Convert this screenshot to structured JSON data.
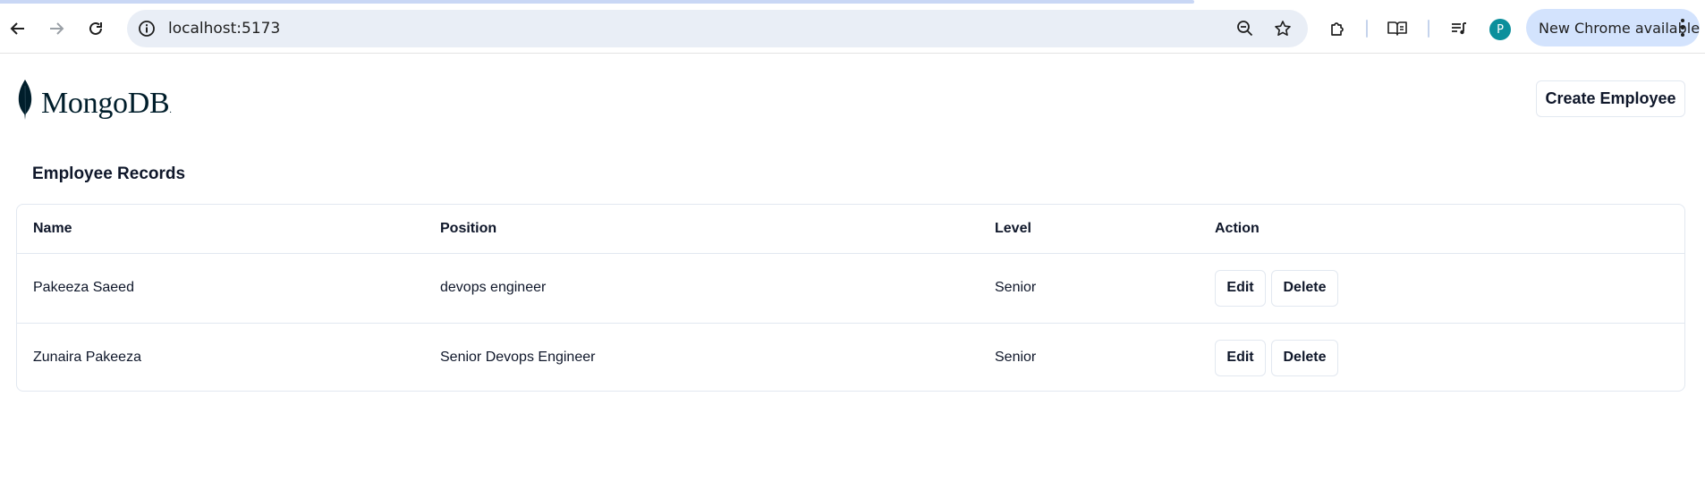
{
  "browser": {
    "url": "localhost:5173",
    "profile_initial": "P",
    "update_label": "New Chrome available",
    "icons": {
      "back": "arrow-left-icon",
      "forward": "arrow-right-icon",
      "reload": "reload-icon",
      "site_info": "info-icon",
      "zoom": "zoom-out-icon",
      "bookmark": "star-icon",
      "extensions": "puzzle-icon",
      "reading_mode": "book-icon",
      "media": "media-queue-icon",
      "menu": "kebab-menu-icon"
    }
  },
  "header": {
    "logo_text": "MongoDB",
    "logo_mark": ".",
    "create_label": "Create Employee"
  },
  "records": {
    "title": "Employee Records",
    "columns": [
      "Name",
      "Position",
      "Level",
      "Action"
    ],
    "rows": [
      {
        "name": "Pakeeza Saeed",
        "position": "devops engineer",
        "level": "Senior",
        "edit_label": "Edit",
        "delete_label": "Delete"
      },
      {
        "name": "Zunaira Pakeeza",
        "position": "Senior Devops Engineer",
        "level": "Senior",
        "edit_label": "Edit",
        "delete_label": "Delete"
      }
    ]
  },
  "colors": {
    "accent": "#0b8f9c",
    "update_pill": "#d3e3fd",
    "omnibox": "#e9eef6",
    "logo_leaf": "#001e2b"
  }
}
